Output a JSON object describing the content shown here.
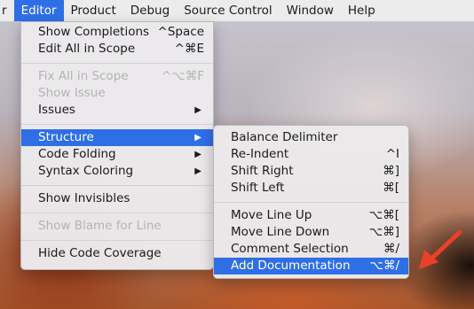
{
  "menubar": {
    "items": [
      "r",
      "Editor",
      "Product",
      "Debug",
      "Source Control",
      "Window",
      "Help"
    ]
  },
  "editor_menu": {
    "items": [
      {
        "label": "Show Completions",
        "shortcut": "^Space"
      },
      {
        "label": "Edit All in Scope",
        "shortcut": "^⌘E"
      },
      {
        "label": "Fix All in Scope",
        "shortcut": "^⌥⌘F"
      },
      {
        "label": "Show Issue",
        "shortcut": ""
      },
      {
        "label": "Issues",
        "shortcut": ""
      },
      {
        "label": "Structure",
        "shortcut": ""
      },
      {
        "label": "Code Folding",
        "shortcut": ""
      },
      {
        "label": "Syntax Coloring",
        "shortcut": ""
      },
      {
        "label": "Show Invisibles",
        "shortcut": ""
      },
      {
        "label": "Show Blame for Line",
        "shortcut": ""
      },
      {
        "label": "Hide Code Coverage",
        "shortcut": ""
      }
    ]
  },
  "structure_menu": {
    "items": [
      {
        "label": "Balance Delimiter",
        "shortcut": ""
      },
      {
        "label": "Re-Indent",
        "shortcut": "^I"
      },
      {
        "label": "Shift Right",
        "shortcut": "⌘]"
      },
      {
        "label": "Shift Left",
        "shortcut": "⌘["
      },
      {
        "label": "Move Line Up",
        "shortcut": "⌥⌘["
      },
      {
        "label": "Move Line Down",
        "shortcut": "⌥⌘]"
      },
      {
        "label": "Comment Selection",
        "shortcut": "⌘/"
      },
      {
        "label": "Add Documentation",
        "shortcut": "⌥⌘/"
      }
    ]
  },
  "colors": {
    "selection": "#2f6fe6",
    "callout_arrow": "#e8412a"
  },
  "icons": {
    "submenu": "submenu-arrow-icon",
    "callout": "callout-arrow-icon"
  }
}
